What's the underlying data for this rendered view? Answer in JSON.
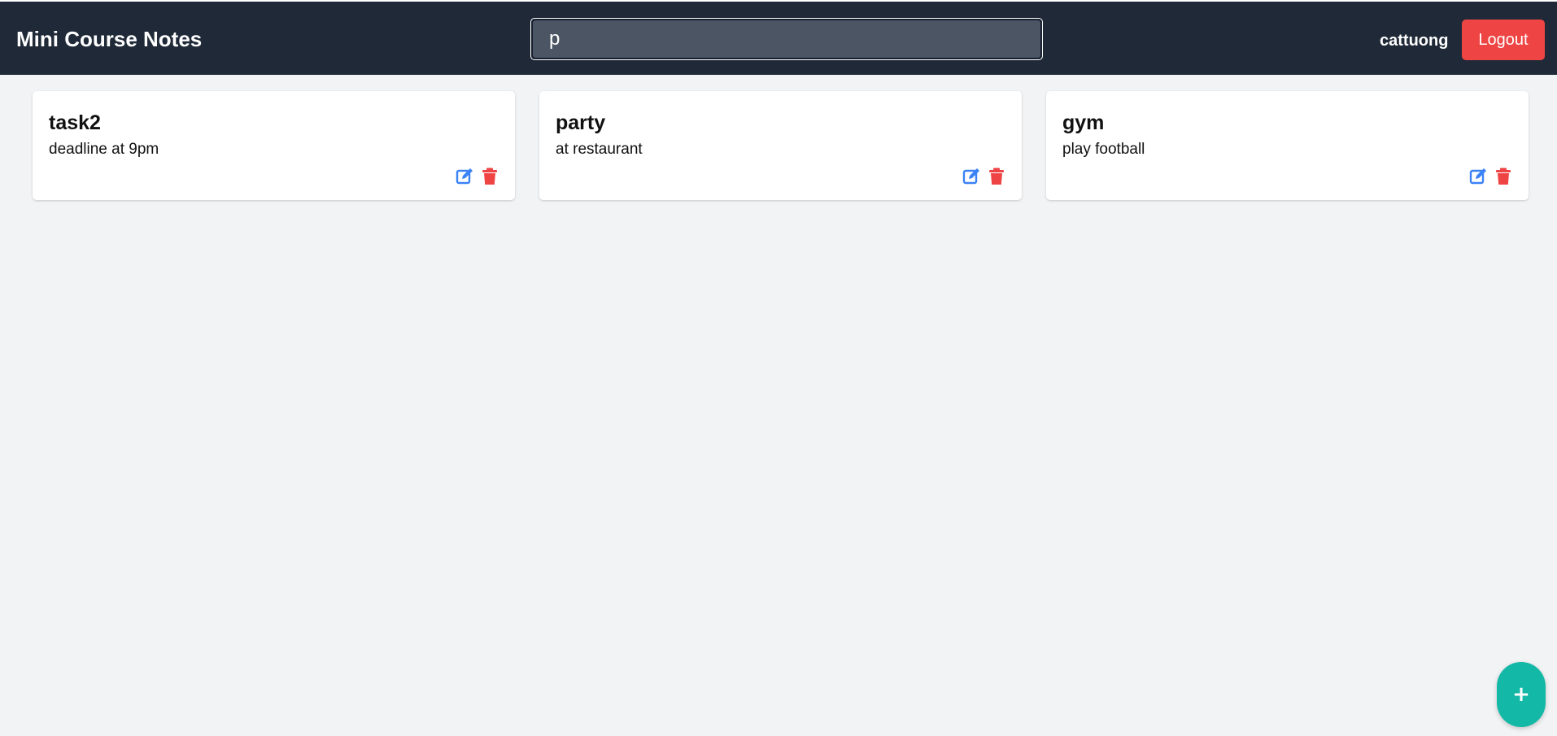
{
  "header": {
    "app_title": "Mini Course Notes",
    "search_value": "p",
    "username": "cattuong",
    "logout_label": "Logout"
  },
  "notes": [
    {
      "title": "task2",
      "body": "deadline at 9pm"
    },
    {
      "title": "party",
      "body": "at restaurant"
    },
    {
      "title": "gym",
      "body": "play football"
    }
  ],
  "icons": {
    "edit": "edit-icon",
    "delete": "trash-icon"
  },
  "fab": {
    "label": "+"
  },
  "colors": {
    "header_bg": "#1f2937",
    "logout_bg": "#ef4444",
    "edit_icon": "#3b82f6",
    "delete_icon": "#ef4444",
    "fab_bg": "#14b8a6",
    "page_bg": "#f2f3f5"
  }
}
